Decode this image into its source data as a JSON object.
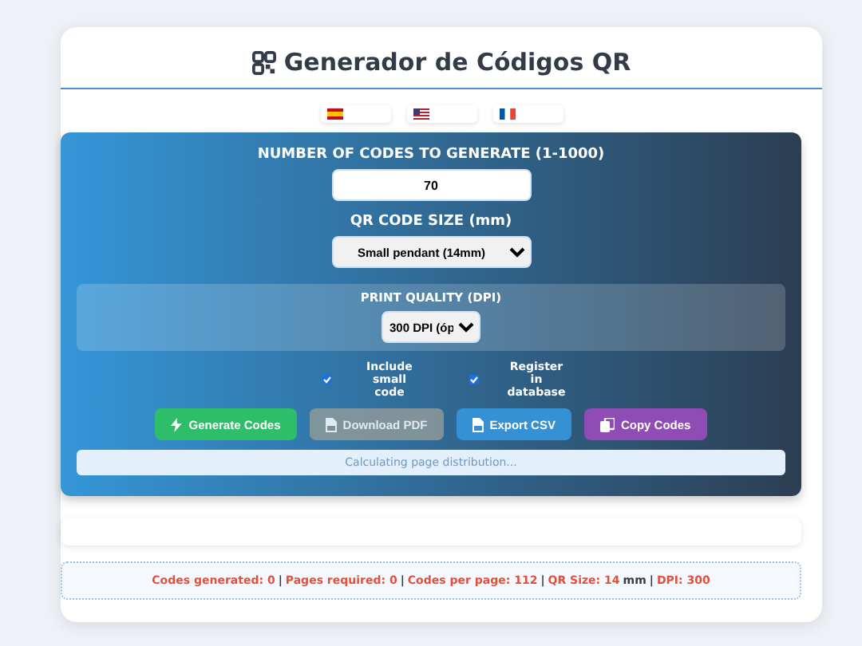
{
  "title": "Generador de Códigos QR",
  "languages": [
    {
      "kind": "es"
    },
    {
      "kind": "us"
    },
    {
      "kind": "fr"
    }
  ],
  "count": {
    "label": "NUMBER OF CODES TO GENERATE (1-1000)",
    "value": "70"
  },
  "size": {
    "label": "QR CODE SIZE (mm)",
    "value": "Small pendant (14mm)"
  },
  "quality": {
    "label": "PRINT QUALITY (DPI)",
    "value": "300 DPI (óp"
  },
  "options": [
    {
      "label": "Include small code",
      "checked": true
    },
    {
      "label": "Register in database",
      "checked": true
    }
  ],
  "buttons": [
    {
      "label": "Generate Codes",
      "kind": "generate",
      "disabled": false
    },
    {
      "label": "Download PDF",
      "kind": "pdf",
      "disabled": true
    },
    {
      "label": "Export CSV",
      "kind": "csv",
      "disabled": false
    },
    {
      "label": "Copy Codes",
      "kind": "copy",
      "disabled": false
    }
  ],
  "progress": {
    "text": "Calculating page distribution..."
  },
  "status_bar": [
    {
      "text": "Codes generated: 0",
      "kind": "value"
    },
    {
      "text": "|",
      "kind": "sep"
    },
    {
      "text": "Pages required: 0",
      "kind": "value"
    },
    {
      "text": "|",
      "kind": "sep"
    },
    {
      "text": "Codes per page: 112",
      "kind": "value"
    },
    {
      "text": "|",
      "kind": "sep"
    },
    {
      "text": "QR Size: 14",
      "kind": "value"
    },
    {
      "text": "mm",
      "kind": "sep"
    },
    {
      "text": "|",
      "kind": "sep"
    },
    {
      "text": "DPI: 300",
      "kind": "value"
    }
  ]
}
